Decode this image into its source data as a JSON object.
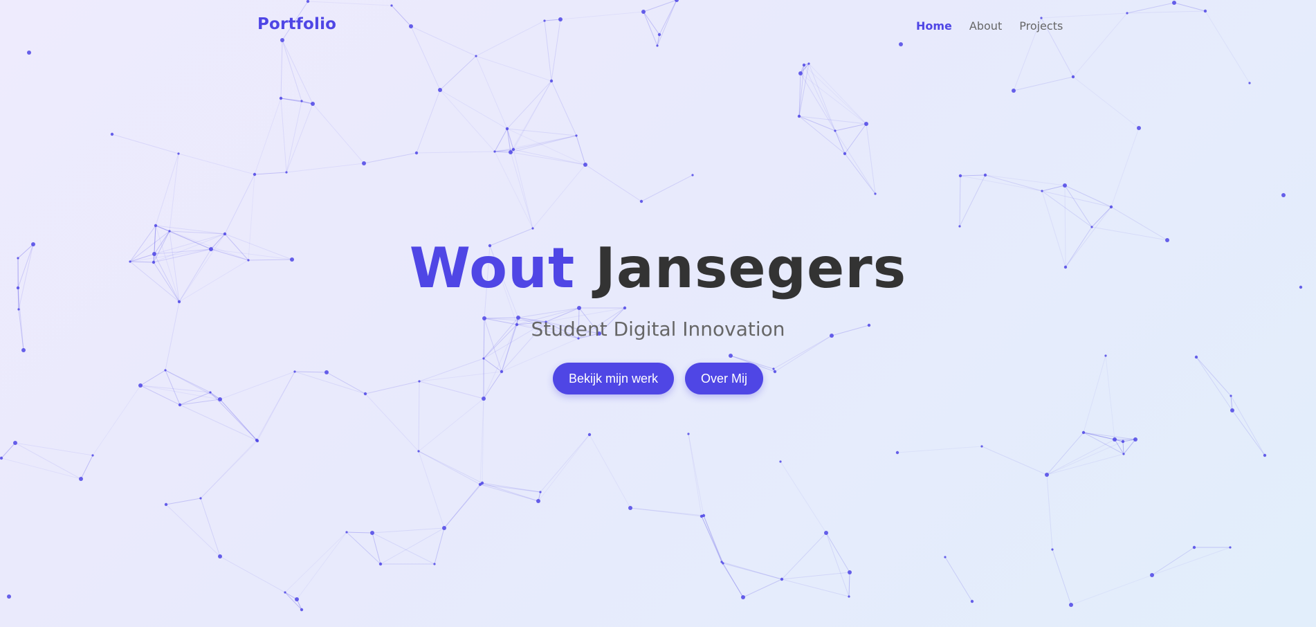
{
  "nav": {
    "brand": "Portfolio",
    "links": [
      {
        "label": "Home",
        "active": true
      },
      {
        "label": "About",
        "active": false
      },
      {
        "label": "Projects",
        "active": false
      }
    ]
  },
  "hero": {
    "first_name": "Wout",
    "last_name": "Jansegers",
    "subtitle": "Student Digital Innovation",
    "buttons": [
      {
        "label": "Bekijk mijn werk"
      },
      {
        "label": "Over Mij"
      }
    ]
  },
  "colors": {
    "accent": "#4f46e5",
    "text_dark": "#333333",
    "text_muted": "#666666"
  }
}
